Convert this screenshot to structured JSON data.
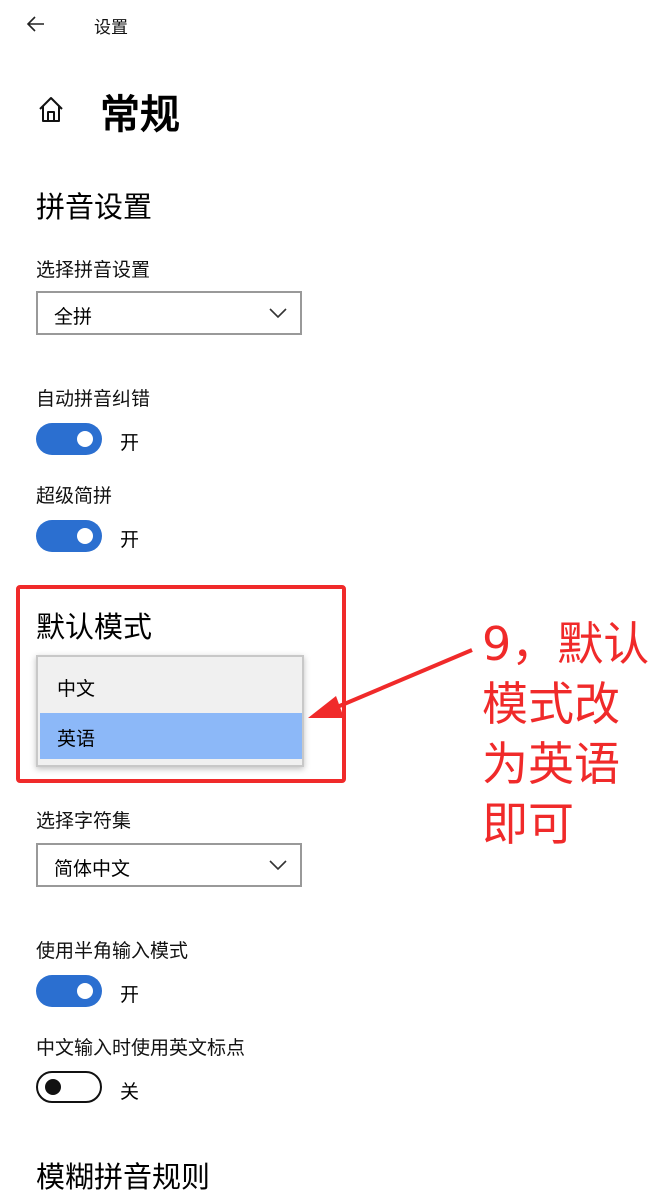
{
  "titlebar": {
    "title": "设置"
  },
  "page": {
    "title": "常规"
  },
  "pinyin_section": {
    "title": "拼音设置",
    "select_label": "选择拼音设置",
    "select_value": "全拼",
    "autocorrect_label": "自动拼音纠错",
    "autocorrect_state": "开",
    "super_abbrev_label": "超级简拼",
    "super_abbrev_state": "开"
  },
  "default_mode": {
    "title": "默认模式",
    "options": [
      "中文",
      "英语"
    ],
    "selected": "英语"
  },
  "charset": {
    "label": "选择字符集",
    "value": "简体中文"
  },
  "halfwidth": {
    "label": "使用半角输入模式",
    "state": "开"
  },
  "english_punct": {
    "label": "中文输入时使用英文标点",
    "state": "关"
  },
  "fuzzy_section": {
    "title": "模糊拼音规则"
  },
  "annotation": {
    "line1": "9，默认",
    "line2": "模式改",
    "line3": "为英语",
    "line4": "即可",
    "color": "#f02a2a"
  },
  "colors": {
    "accent": "#2b6fd0",
    "selection": "#8cb8f8"
  }
}
